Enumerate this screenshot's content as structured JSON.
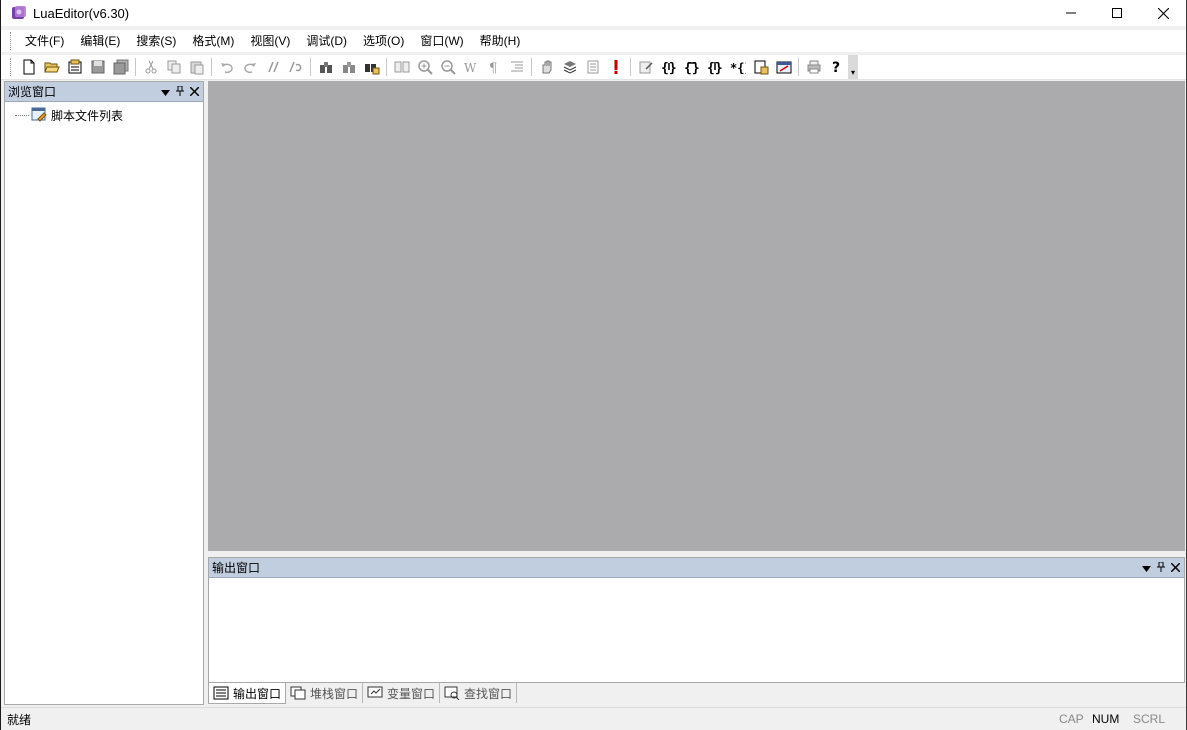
{
  "window": {
    "title": "LuaEditor(v6.30)"
  },
  "menubar": {
    "items": [
      "文件(F)",
      "编辑(E)",
      "搜索(S)",
      "格式(M)",
      "视图(V)",
      "调试(D)",
      "选项(O)",
      "窗口(W)",
      "帮助(H)"
    ]
  },
  "browse_panel": {
    "title": "浏览窗口",
    "tree_root": "脚本文件列表"
  },
  "output_panel": {
    "title": "输出窗口",
    "tabs": [
      "输出窗口",
      "堆栈窗口",
      "变量窗口",
      "查找窗口"
    ]
  },
  "statusbar": {
    "text": "就绪",
    "cap": "CAP",
    "num": "NUM",
    "scrl": "SCRL"
  },
  "colors": {
    "mdi_background": "#abaaad",
    "panel_header": "#c0cee0"
  }
}
